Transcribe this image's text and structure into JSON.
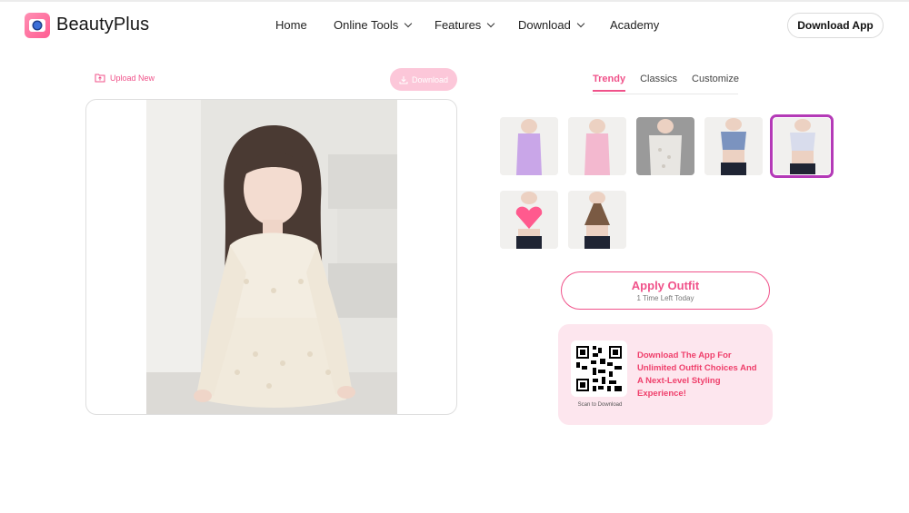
{
  "header": {
    "brand": "BeautyPlus",
    "nav": [
      {
        "label": "Home"
      },
      {
        "label": "Online Tools"
      },
      {
        "label": "Features"
      },
      {
        "label": "Download"
      },
      {
        "label": "Academy"
      }
    ],
    "download_app": "Download App"
  },
  "editor": {
    "upload_new": "Upload New",
    "download": "Download"
  },
  "tabs": [
    "Trendy",
    "Classics",
    "Customize"
  ],
  "active_tab": "Trendy",
  "outfits": [
    {
      "name": "lavender-slip-dress",
      "color": "#c9a6e8"
    },
    {
      "name": "pink-satin-dress",
      "color": "#f3b8cf"
    },
    {
      "name": "white-floral-dress",
      "color": "#e8e6e2"
    },
    {
      "name": "denim-crop-top",
      "color": "#7b93bf"
    },
    {
      "name": "pearl-bustier-top",
      "color": "#d8dcec",
      "selected": true
    },
    {
      "name": "pink-heart-top",
      "color": "#ff5a8e"
    },
    {
      "name": "brown-halter-top",
      "color": "#7a5a43"
    }
  ],
  "apply": {
    "label": "Apply Outfit",
    "sub": "1 Time Left Today"
  },
  "promo": {
    "qr_caption": "Scan to Download",
    "text": "Download The App For Unlimited Outfit Choices And A Next-Level Styling Experience!"
  },
  "colors": {
    "accent": "#f0528a",
    "selected_outline": "#b43ab7",
    "promo_bg": "#fde6ee",
    "promo_text": "#ef3f6b"
  }
}
